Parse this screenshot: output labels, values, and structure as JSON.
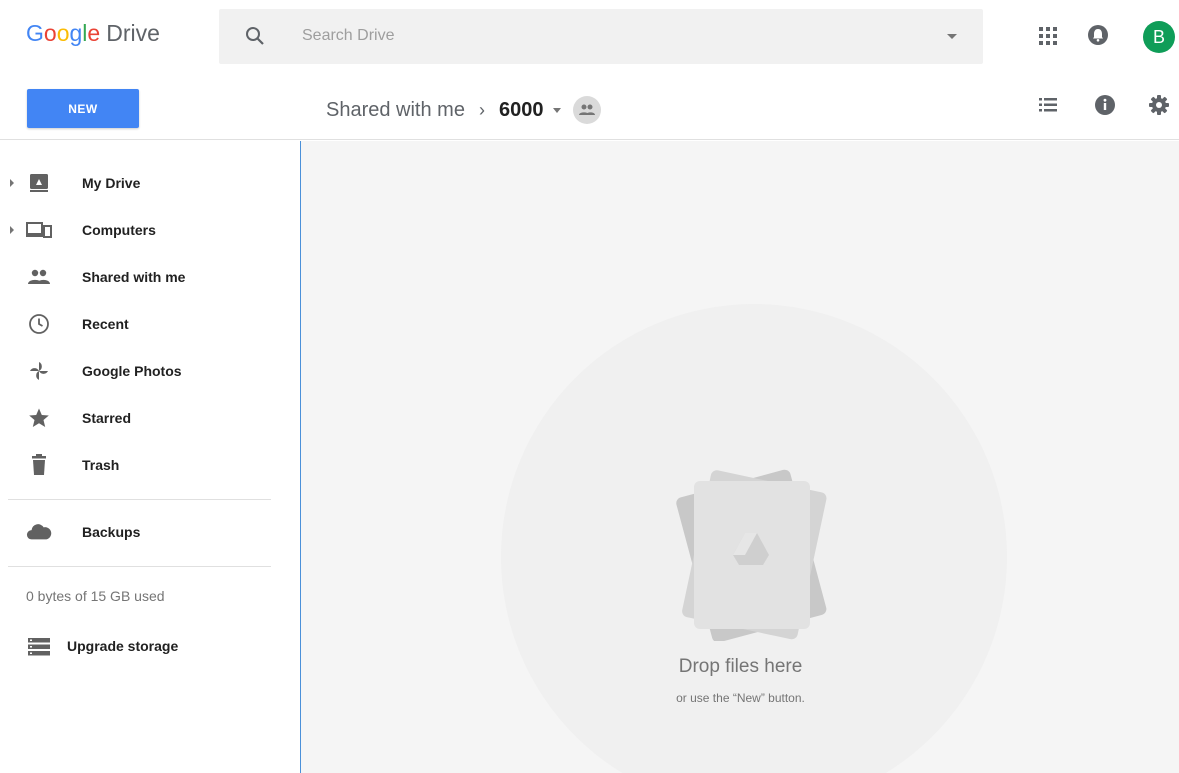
{
  "app": {
    "logo_letters": [
      "G",
      "o",
      "o",
      "g",
      "l",
      "e"
    ],
    "product": "Drive"
  },
  "search": {
    "placeholder": "Search Drive"
  },
  "user": {
    "initial": "B",
    "avatar_color": "#0f9d58"
  },
  "toolbar": {
    "new_label": "NEW",
    "new_color": "#4285f4"
  },
  "breadcrumb": {
    "parent": "Shared with me",
    "separator": "›",
    "current": "6000"
  },
  "sidebar": {
    "items": [
      {
        "label": "My Drive",
        "icon": "drive-icon",
        "expandable": true
      },
      {
        "label": "Computers",
        "icon": "computers-icon",
        "expandable": true
      },
      {
        "label": "Shared with me",
        "icon": "people-icon",
        "expandable": false
      },
      {
        "label": "Recent",
        "icon": "clock-icon",
        "expandable": false
      },
      {
        "label": "Google Photos",
        "icon": "photos-pinwheel-icon",
        "expandable": false
      },
      {
        "label": "Starred",
        "icon": "star-icon",
        "expandable": false
      },
      {
        "label": "Trash",
        "icon": "trash-icon",
        "expandable": false
      },
      {
        "label": "Backups",
        "icon": "cloud-icon",
        "expandable": false
      }
    ],
    "storage_text": "0 bytes of 15 GB used",
    "upgrade_label": "Upgrade storage"
  },
  "main": {
    "drop_title": "Drop files here",
    "drop_subtitle": "or use the “New” button."
  },
  "colors": {
    "accent": "#4285f4",
    "main_background": "#f5f5f5"
  }
}
